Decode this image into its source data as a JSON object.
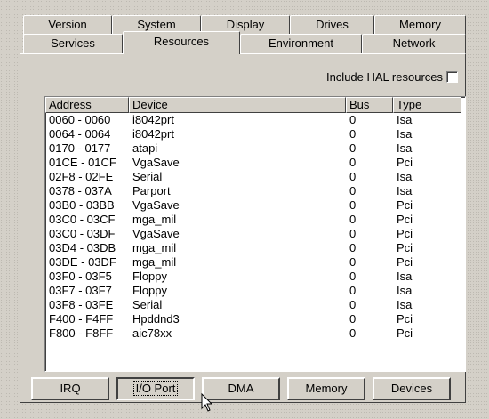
{
  "tabs_back": [
    "Version",
    "System",
    "Display",
    "Drives",
    "Memory"
  ],
  "tabs_front": [
    "Services",
    "Resources",
    "Environment",
    "Network"
  ],
  "active_tab": "Resources",
  "hal_checkbox": {
    "label": "Include HAL resources",
    "checked": false
  },
  "listview": {
    "columns": [
      "Address",
      "Device",
      "Bus",
      "Type"
    ],
    "rows": [
      [
        "0060 - 0060",
        "i8042prt",
        "0",
        "Isa"
      ],
      [
        "0064 - 0064",
        "i8042prt",
        "0",
        "Isa"
      ],
      [
        "0170 - 0177",
        "atapi",
        "0",
        "Isa"
      ],
      [
        "01CE - 01CF",
        "VgaSave",
        "0",
        "Pci"
      ],
      [
        "02F8 - 02FE",
        "Serial",
        "0",
        "Isa"
      ],
      [
        "0378 - 037A",
        "Parport",
        "0",
        "Isa"
      ],
      [
        "03B0 - 03BB",
        "VgaSave",
        "0",
        "Pci"
      ],
      [
        "03C0 - 03CF",
        "mga_mil",
        "0",
        "Pci"
      ],
      [
        "03C0 - 03DF",
        "VgaSave",
        "0",
        "Pci"
      ],
      [
        "03D4 - 03DB",
        "mga_mil",
        "0",
        "Pci"
      ],
      [
        "03DE - 03DF",
        "mga_mil",
        "0",
        "Pci"
      ],
      [
        "03F0 - 03F5",
        "Floppy",
        "0",
        "Isa"
      ],
      [
        "03F7 - 03F7",
        "Floppy",
        "0",
        "Isa"
      ],
      [
        "03F8 - 03FE",
        "Serial",
        "0",
        "Isa"
      ],
      [
        "F400 - F4FF",
        "Hpddnd3",
        "0",
        "Pci"
      ],
      [
        "F800 - F8FF",
        "aic78xx",
        "0",
        "Pci"
      ]
    ]
  },
  "buttons": [
    "IRQ",
    "I/O Port",
    "DMA",
    "Memory",
    "Devices"
  ],
  "active_button": "I/O Port",
  "colors": {
    "face": "#d4d0c8",
    "highlight": "#ffffff",
    "shadow": "#404040"
  }
}
